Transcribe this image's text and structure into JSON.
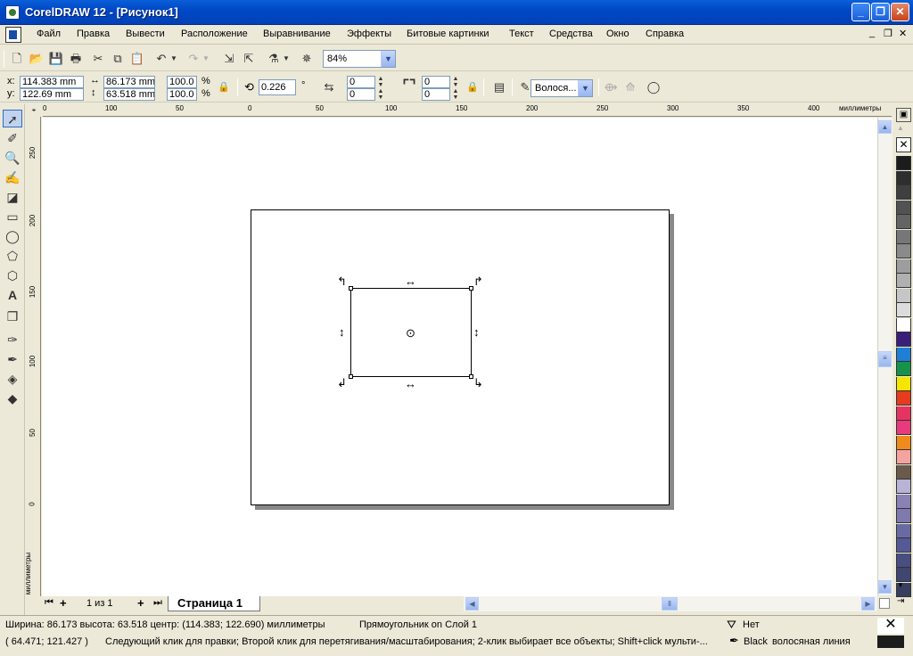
{
  "window": {
    "title": "CorelDRAW 12 - [Рисунок1]",
    "min": "_",
    "max": "❐",
    "close": "✕"
  },
  "menu": {
    "items": [
      "Файл",
      "Правка",
      "Вывести",
      "Расположение",
      "Выравнивание",
      "Эффекты",
      "Битовые картинки",
      "Текст",
      "Средства",
      "Окно",
      "Справка"
    ]
  },
  "standard": {
    "zoom": "84%"
  },
  "property": {
    "x_label": "x:",
    "x": "114.383 mm",
    "y_label": "y:",
    "y": "122.69 mm",
    "w": "86.173 mm",
    "h": "63.518 mm",
    "scale_w": "100.0",
    "scale_h": "100.0",
    "pct": "%",
    "angle": "0.226",
    "deg": "°",
    "corner_tl": "0",
    "corner_bl": "0",
    "corner_tr": "0",
    "corner_br": "0",
    "outline": "Волося..."
  },
  "ruler": {
    "unit": "миллиметры",
    "h_ticks": [
      "0",
      "100",
      "50",
      "0",
      "50",
      "100",
      "150",
      "200",
      "250",
      "300",
      "350",
      "400"
    ],
    "v_ticks": [
      "250",
      "200",
      "150",
      "100",
      "50",
      "0"
    ]
  },
  "pages": {
    "counter": "1 из 1",
    "tab": "Страница 1"
  },
  "palette": {
    "colors": [
      "#1c1c1c",
      "#2e2e2e",
      "#3f3f3f",
      "#525252",
      "#646464",
      "#777777",
      "#8a8a8a",
      "#9d9d9d",
      "#b0b0b0",
      "#c6c6c6",
      "#dcdcdc",
      "#ffffff",
      "#3a1f7a",
      "#1f7fd4",
      "#17924a",
      "#f4e600",
      "#e63b1f",
      "#e63462",
      "#e83a7c",
      "#f08a1c",
      "#f4a3a0",
      "#6a5a4c",
      "#b9b3d6",
      "#8a82b5",
      "#7f79ad",
      "#6a6aa3",
      "#555a96",
      "#474e80",
      "#3f4670",
      "#383e5e"
    ]
  },
  "status": {
    "line1": "Ширина: 86.173  высота: 63.518  центр: (114.383; 122.690)  миллиметры",
    "object": "Прямоугольник on Слой 1",
    "coords": "( 64.471; 121.427 )",
    "hint": "Следующий клик для правки; Второй клик для перетягивания/масштабирования; 2-клик выбирает все объекты; Shift+click мульти-...",
    "fill": "Нет",
    "outline_color": "Black",
    "outline_type": "волосяная линия"
  }
}
